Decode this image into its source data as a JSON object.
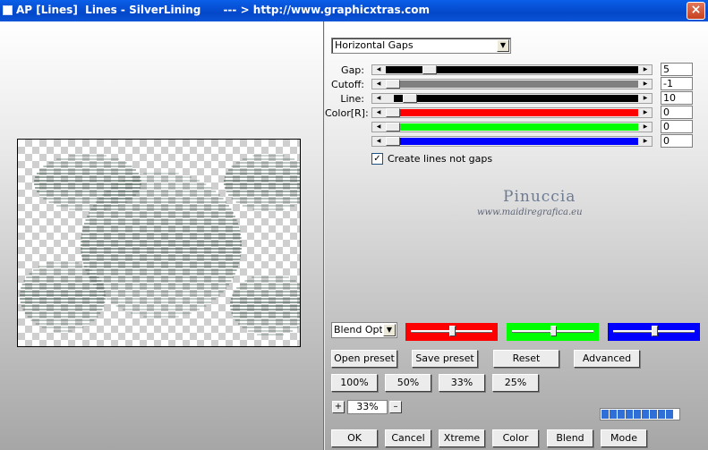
{
  "window": {
    "title": "AP [Lines]  Lines - SilverLining      --- > http://www.graphicxtras.com",
    "close_label": "×"
  },
  "mode_dropdown": {
    "value": "Horizontal Gaps"
  },
  "params": [
    {
      "label": "Gap:",
      "value": "5",
      "thumb_fraction": 0.05,
      "track_color": "#000000"
    },
    {
      "label": "Cutoff:",
      "value": "-1",
      "thumb_fraction": 0.0,
      "track_color": "#808080"
    },
    {
      "label": "Line:",
      "value": "10",
      "thumb_fraction": 0.0,
      "track_color": "#000000",
      "track_start_fraction": 0.03
    },
    {
      "label": "Color[R]:",
      "value": "0",
      "thumb_fraction": 0.0,
      "track_color": "#ff0000"
    },
    {
      "label": "",
      "value": "0",
      "thumb_fraction": 0.0,
      "track_color": "#00ff00"
    },
    {
      "label": "",
      "value": "0",
      "thumb_fraction": 0.0,
      "track_color": "#0000ff"
    }
  ],
  "create_lines_checkbox": {
    "label": "Create lines not gaps",
    "checked": true,
    "mark": "✓"
  },
  "watermark": {
    "name": "Pinuccia",
    "url": "www.maidiregrafica.eu"
  },
  "blend_options": {
    "value": "Blend Options"
  },
  "color_sliders": [
    {
      "name": "red",
      "color": "#ff0000",
      "level": 0.5
    },
    {
      "name": "green",
      "color": "#00ff00",
      "level": 0.5
    },
    {
      "name": "blue",
      "color": "#0000ff",
      "level": 0.5
    }
  ],
  "preset_buttons": {
    "open": "Open preset",
    "save": "Save preset",
    "reset": "Reset",
    "advanced": "Advanced"
  },
  "zoom_buttons": [
    "100%",
    "50%",
    "33%",
    "25%"
  ],
  "zoom": {
    "plus": "+",
    "minus": "–",
    "value": "33%"
  },
  "progress": {
    "segments": 9
  },
  "bottom_buttons": {
    "ok": "OK",
    "cancel": "Cancel",
    "xtreme": "Xtreme",
    "color": "Color",
    "blend": "Blend",
    "mode": "Mode"
  },
  "icons": {
    "app": "window-icon",
    "close": "close-icon",
    "dropdown": "chevron-down-icon",
    "left": "arrow-left-icon",
    "right": "arrow-right-icon"
  }
}
